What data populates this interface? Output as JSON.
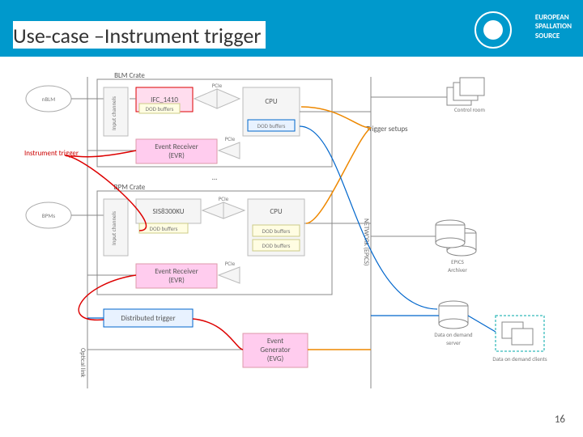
{
  "header": {
    "title": "Use-case –Instrument trigger",
    "org_line1": "EUROPEAN",
    "org_line2": "SPALLATION",
    "org_line3": "SOURCE"
  },
  "page_number": "16",
  "diagram": {
    "crates": {
      "blm": "BLM Crate",
      "bpm": "BPM Crate"
    },
    "clouds": {
      "nblm": "nBLM",
      "bpms": "BPMs"
    },
    "blocks": {
      "input_channels1": "Input channels",
      "ifc1410": "IFC_1410",
      "dod_small": "DOD buffers",
      "cpu1": "CPU",
      "dod_buf1": "DOD buffers",
      "evr1_a": "Event Receiver",
      "evr1_b": "(EVR)",
      "ellipsis": "...",
      "input_channels2": "Input channels",
      "sis8300": "SIS8300KU",
      "dod_buf2a": "DOD buffers",
      "cpu2": "CPU",
      "dod_buf2b": "DOD buffers",
      "dod_buf2c": "DOD buffers",
      "evr2_a": "Event Receiver",
      "evr2_b": "(EVR)",
      "dist_trigger": "Distributed trigger",
      "evg_a": "Event",
      "evg_b": "Generator",
      "evg_c": "(EVG)"
    },
    "bus": {
      "pcie": "PCIe",
      "network": "NETWORK (EPICS)",
      "optical": "Optical link"
    },
    "annot": {
      "instr_trig": "Instrument trigger",
      "trig_setups": "Trigger setups"
    },
    "right": {
      "control_room": "Control room",
      "archiver_a": "EPICS",
      "archiver_b": "Archiver",
      "dod_server_a": "Data on demand",
      "dod_server_b": "server",
      "dod_clients": "Data on demand clients"
    }
  }
}
